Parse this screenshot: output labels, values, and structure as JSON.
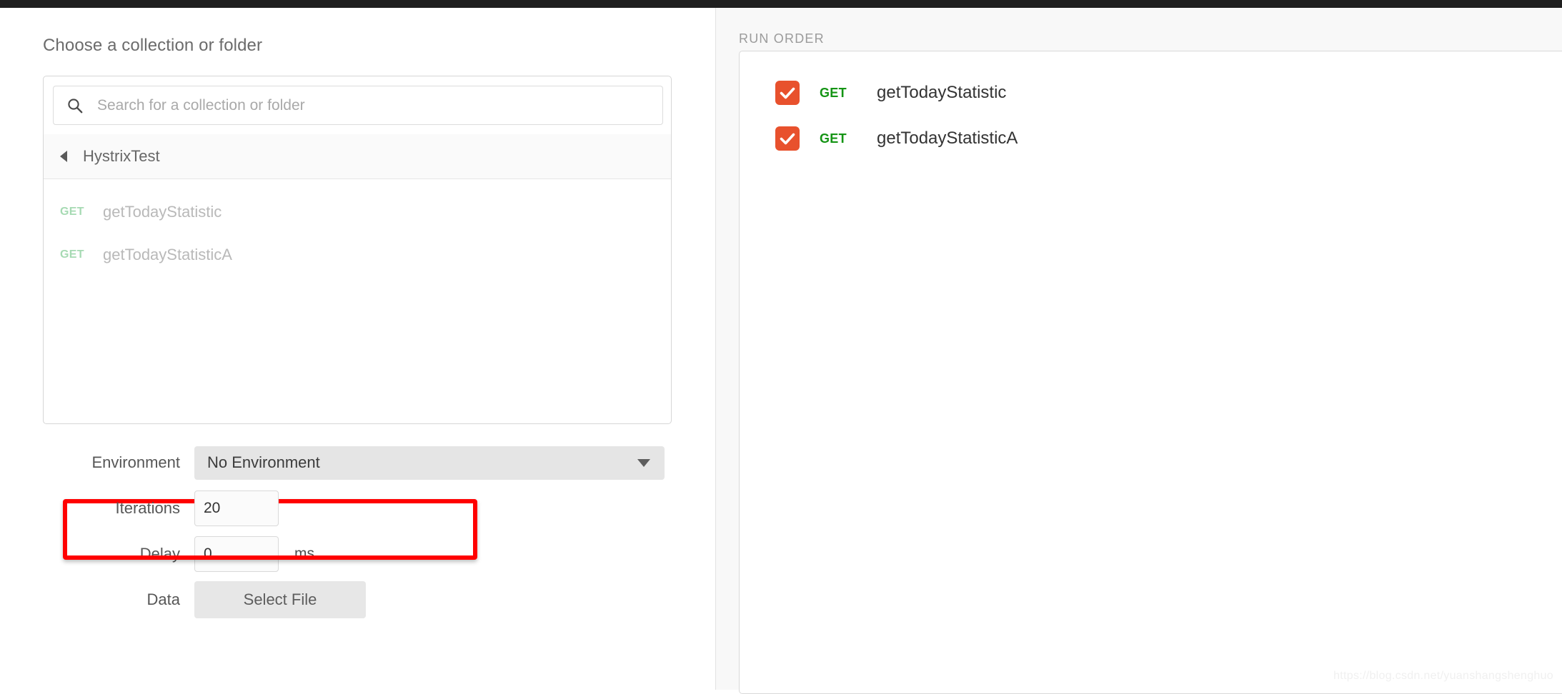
{
  "window": {
    "titlebar_color": "#1f1f1f"
  },
  "left": {
    "title": "Choose a collection or folder",
    "search": {
      "placeholder": "Search for a collection or folder",
      "value": "",
      "icon": "search-icon"
    },
    "breadcrumb": {
      "back_icon": "back-caret-icon",
      "label": "HystrixTest"
    },
    "requests": [
      {
        "method": "GET",
        "name": "getTodayStatistic"
      },
      {
        "method": "GET",
        "name": "getTodayStatisticA"
      }
    ],
    "form": {
      "environment": {
        "label": "Environment",
        "value": "No Environment",
        "caret_icon": "chevron-down-icon"
      },
      "iterations": {
        "label": "Iterations",
        "value": "20"
      },
      "delay": {
        "label": "Delay",
        "value": "0",
        "unit": "ms"
      },
      "data": {
        "label": "Data",
        "button_label": "Select File"
      }
    }
  },
  "right": {
    "title": "RUN ORDER",
    "items": [
      {
        "checked": true,
        "method": "GET",
        "name": "getTodayStatistic"
      },
      {
        "checked": true,
        "method": "GET",
        "name": "getTodayStatisticA"
      }
    ]
  },
  "watermark": "https://blog.csdn.net/yuanshangshenghuo",
  "colors": {
    "checkbox_orange": "#e8512d",
    "method_green_right": "#149414",
    "method_green_left": "#a6dab3",
    "annotation_red": "#ff0000",
    "right_pane_bg": "#f8f8f8"
  }
}
